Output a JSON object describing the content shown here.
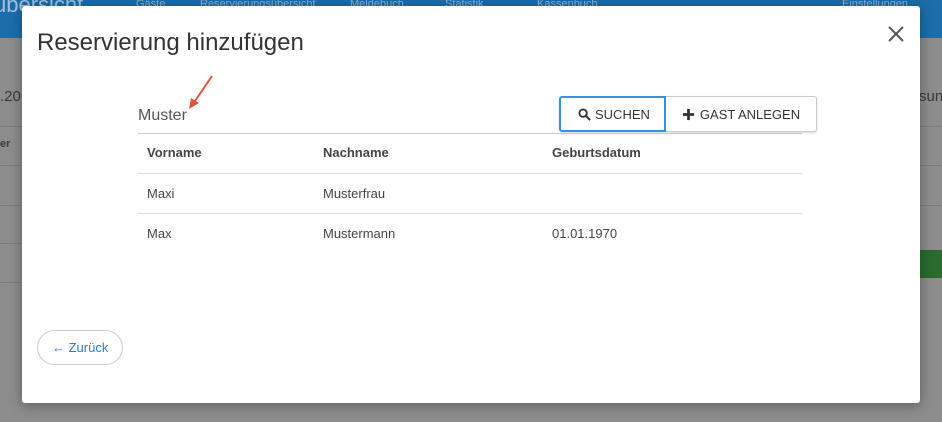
{
  "background": {
    "brand": "übersicht",
    "nav": [
      "Gäste",
      "Reservierungsübersicht",
      "Meldebuch",
      "Statistik",
      "Kassenbuch",
      "Einstellungen"
    ],
    "left_snippet": ".20",
    "left_header": "er",
    "right_snippet": "sun"
  },
  "modal": {
    "title": "Reservierung hinzufügen",
    "close_icon": "close-icon",
    "search": {
      "value": "Muster",
      "placeholder": ""
    },
    "buttons": {
      "search_label": "SUCHEN",
      "search_icon": "search-icon",
      "add_label": "GAST ANLEGEN",
      "add_icon": "plus-icon"
    },
    "table": {
      "columns": [
        "Vorname",
        "Nachname",
        "Geburtsdatum"
      ],
      "rows": [
        [
          "Maxi",
          "Musterfrau",
          ""
        ],
        [
          "Max",
          "Mustermann",
          "01.01.1970"
        ]
      ]
    },
    "back_label": "← Zurück",
    "colors": {
      "accent": "#3b8eea",
      "link": "#2a7fd4",
      "arrow": "#e0533d"
    }
  }
}
